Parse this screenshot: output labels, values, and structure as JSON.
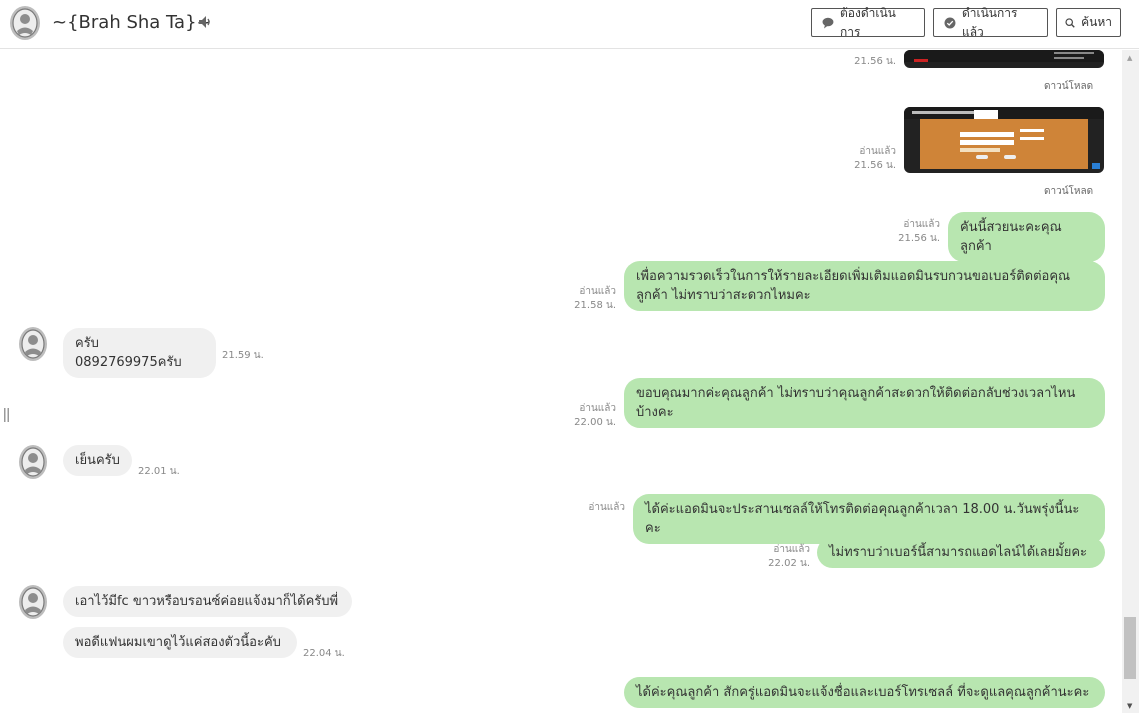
{
  "header": {
    "contact_name": "~{Brah Sha Ta}~",
    "btn_pending": "ต้องดำเนินการ",
    "btn_done": "ดำเนินการแล้ว",
    "btn_search": "ค้นหา"
  },
  "messages": [
    {
      "dir": "out",
      "type": "image",
      "status": "",
      "time": "21.56 น.",
      "download": "ดาวน์โหลด"
    },
    {
      "dir": "out",
      "type": "image",
      "status": "อ่านแล้ว",
      "time": "21.56 น.",
      "download": "ดาวน์โหลด"
    },
    {
      "dir": "out",
      "type": "text",
      "status": "อ่านแล้ว",
      "time": "21.56 น.",
      "text": "คันนี้สวยนะคะคุณลูกค้า"
    },
    {
      "dir": "out",
      "type": "text",
      "status": "อ่านแล้ว",
      "time": "21.58 น.",
      "text": "เพื่อความรวดเร็วในการให้รายละเอียดเพิ่มเติมแอดมินรบกวนขอเบอร์ติดต่อคุณลูกค้า ไม่ทราบว่าสะดวกไหมคะ"
    },
    {
      "dir": "in",
      "type": "text",
      "time": "21.59 น.",
      "text": "ครับ 0892769975ครับ"
    },
    {
      "dir": "out",
      "type": "text",
      "status": "อ่านแล้ว",
      "time": "22.00 น.",
      "text": "ขอบคุณมากค่ะคุณลูกค้า ไม่ทราบว่าคุณลูกค้าสะดวกให้ติดต่อกลับช่วงเวลาไหนบ้างคะ"
    },
    {
      "dir": "in",
      "type": "text",
      "time": "22.01 น.",
      "text": "เย็นครับ"
    },
    {
      "dir": "out",
      "type": "text",
      "status": "อ่านแล้ว",
      "time": "",
      "text": "ได้ค่ะแอดมินจะประสานเซลล์ให้โทรติดต่อคุณลูกค้าเวลา 18.00 น.วันพรุ่งนี้นะคะ"
    },
    {
      "dir": "out",
      "type": "text",
      "status": "อ่านแล้ว",
      "time": "22.02 น.",
      "text": "ไม่ทราบว่าเบอร์นี้สามารถแอดไลน์ได้เลยมั้ยคะ"
    },
    {
      "dir": "in",
      "type": "text",
      "time": "",
      "text": "เอาไว้มีfc ขาวหรือบรอนซ์ค่อยแจ้งมาก็ได้ครับพี่"
    },
    {
      "dir": "in",
      "type": "text",
      "time": "22.04 น.",
      "text": "พอดีแฟนผมเขาดูไว้แค่สองตัวนี้อะคับ"
    },
    {
      "dir": "out",
      "type": "text",
      "status": "",
      "time": "",
      "text": "ได้ค่ะคุณลูกค้า สักครู่แอดมินจะแจ้งชื่อและเบอร์โทรเซลล์ ที่จะดูแลคุณลูกค้านะคะ"
    }
  ],
  "colors": {
    "outgoing_bubble": "#b8e6b0",
    "incoming_bubble": "#f0f0f0",
    "header_border": "#e3e3e3"
  },
  "icons": {
    "pending": "speech-bubble-icon",
    "done": "check-bubble-icon",
    "search": "search-icon",
    "sound": "speaker-icon"
  }
}
